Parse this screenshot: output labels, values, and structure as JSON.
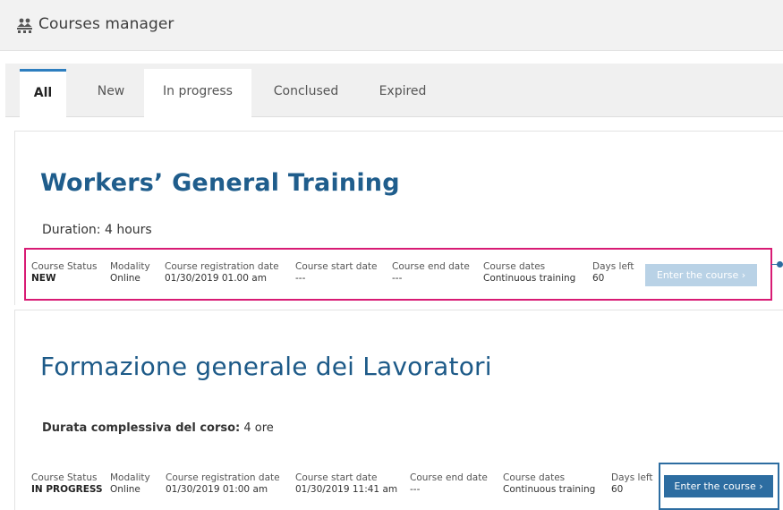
{
  "header": {
    "title": "Courses manager",
    "icon": "courses-icon"
  },
  "tabs": [
    {
      "label": "All",
      "active": true
    },
    {
      "label": "New",
      "active": false
    },
    {
      "label": "In progress",
      "active": false
    },
    {
      "label": "Conclused",
      "active": false
    },
    {
      "label": "Expired",
      "active": false
    }
  ],
  "courses": [
    {
      "title": "Workers’ General Training",
      "duration_label": "Duration:",
      "duration_value": "4 hours",
      "status_label": "Course Status",
      "status_value": "NEW",
      "modality_label": "Modality",
      "modality_value": "Online",
      "registration_label": "Course registration date",
      "registration_value": "01/30/2019 01.00 am",
      "start_label": "Course start date",
      "start_value": "---",
      "end_label": "Course end date",
      "end_value": "---",
      "dates_label": "Course dates",
      "dates_value": "Continuous training",
      "days_label": "Days left",
      "days_value": "60",
      "enter_label": "Enter the course  ›",
      "enter_enabled": false
    },
    {
      "title": "Formazione generale dei Lavoratori",
      "duration_label": "Durata complessiva del corso:",
      "duration_value": "4 ore",
      "status_label": "Course Status",
      "status_value": "IN PROGRESS",
      "modality_label": "Modality",
      "modality_value": "Online",
      "registration_label": "Course registration date",
      "registration_value": "01/30/2019 01:00 am",
      "start_label": "Course start date",
      "start_value": "01/30/2019 11:41 am",
      "end_label": "Course end date",
      "end_value": "---",
      "dates_label": "Course dates",
      "dates_value": "Continuous training",
      "days_label": "Days left",
      "days_value": "60",
      "enter_label": "Enter the course  ›",
      "enter_enabled": true
    }
  ],
  "colors": {
    "accent": "#2d7ebf",
    "title_blue": "#1f5d8c",
    "highlight_pink": "#d81b74",
    "button_enabled": "#2d6da1",
    "button_disabled": "#b9d2e6"
  }
}
